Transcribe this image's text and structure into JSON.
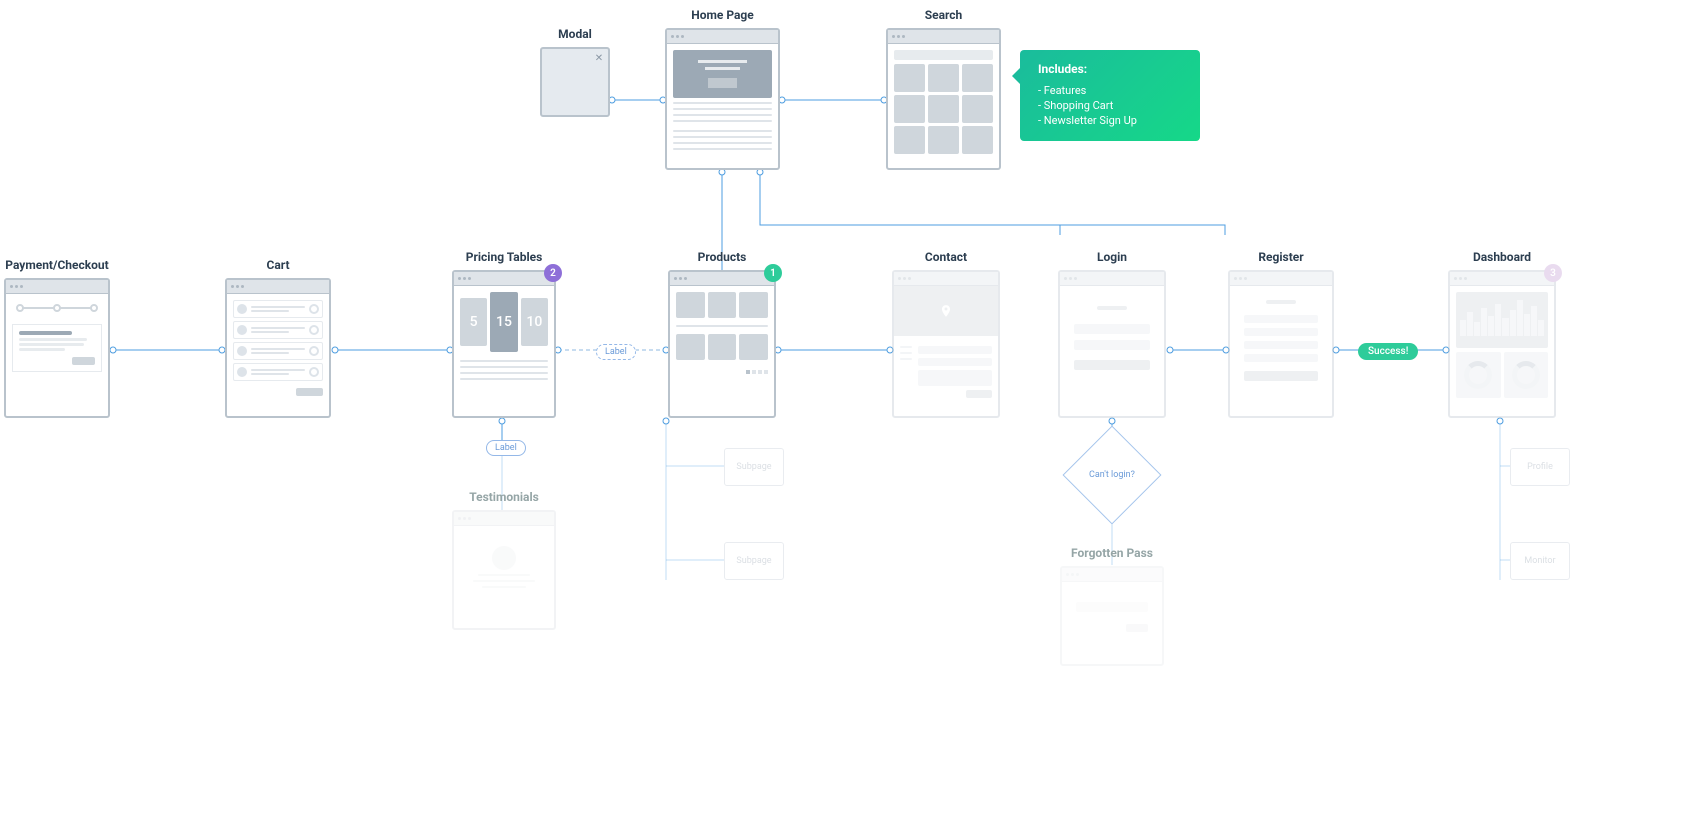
{
  "nodes": {
    "home": {
      "title": "Home Page"
    },
    "search": {
      "title": "Search"
    },
    "modal": {
      "title": "Modal"
    },
    "payment": {
      "title": "Payment/Checkout"
    },
    "cart": {
      "title": "Cart"
    },
    "pricing": {
      "title": "Pricing Tables",
      "badge": "2",
      "prices": [
        "5",
        "15",
        "10"
      ]
    },
    "products": {
      "title": "Products",
      "badge": "1"
    },
    "contact": {
      "title": "Contact"
    },
    "login": {
      "title": "Login"
    },
    "register": {
      "title": "Register"
    },
    "dashboard": {
      "title": "Dashboard",
      "badge": "3"
    },
    "testimonials": {
      "title": "Testimonials"
    },
    "forgotten_pass": {
      "title": "Forgotten Pass"
    }
  },
  "callout": {
    "title": "Includes:",
    "items": [
      "- Features",
      "- Shopping Cart",
      "- Newsletter Sign Up"
    ]
  },
  "labels": {
    "label1": "Label",
    "label2": "Label",
    "success": "Success!"
  },
  "decision": {
    "text": "Can't login?"
  },
  "subpages": {
    "s1": "Subpage",
    "s2": "Subpage",
    "profile": "Profile",
    "monitor": "Monitor"
  }
}
